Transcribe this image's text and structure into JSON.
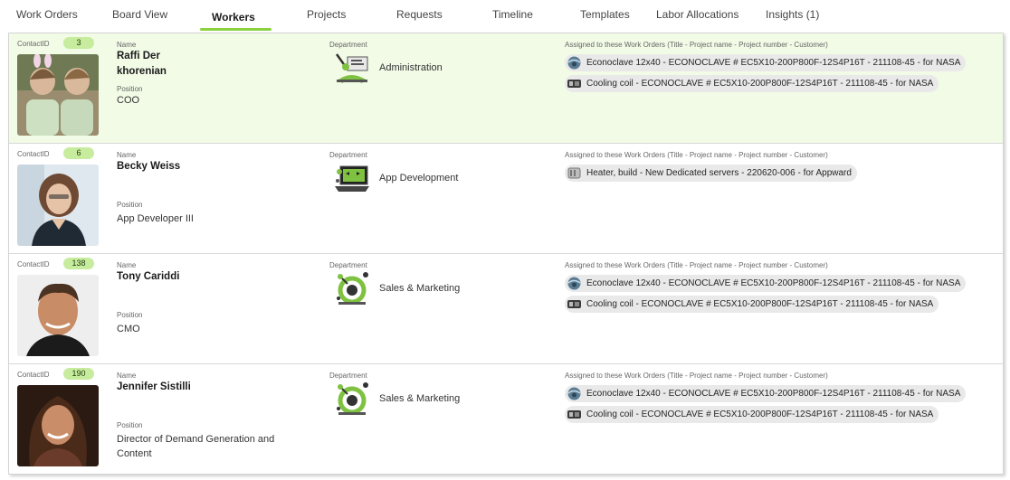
{
  "tabs": [
    {
      "label": "Work Orders"
    },
    {
      "label": "Board View"
    },
    {
      "label": "Workers",
      "active": true
    },
    {
      "label": "Projects"
    },
    {
      "label": "Requests"
    },
    {
      "label": "Timeline"
    },
    {
      "label": "Templates"
    },
    {
      "label": "Labor Allocations"
    },
    {
      "label": "Insights (1)"
    }
  ],
  "colors": {
    "accent": "#8cd140",
    "selected_row": "#f1fbe6",
    "badge": "#c7ec9d",
    "pill": "#e9e9e9"
  },
  "labels": {
    "contact_id": "ContactID",
    "name": "Name",
    "position": "Position",
    "department": "Department",
    "assigned": "Assigned to these Work Orders (Title - Project name - Project number - Customer)"
  },
  "workers": [
    {
      "contact_id": "3",
      "name": "Raffi Der khorenian",
      "position": "COO",
      "department": "Administration",
      "department_icon": "administration-icon",
      "photo": "avatar-photo",
      "selected": true,
      "work_orders": [
        {
          "text": "Econoclave 12x40 - ECONOCLAVE # EC5X10-200P800F-12S4P16T - 211108-45 - for NASA",
          "icon": "econoclave-icon"
        },
        {
          "text": "Cooling coil - ECONOCLAVE # EC5X10-200P800F-12S4P16T - 211108-45 - for NASA",
          "icon": "cooling-coil-icon"
        }
      ]
    },
    {
      "contact_id": "6",
      "name": "Becky Weiss",
      "position": "App Developer III",
      "department": "App Development",
      "department_icon": "app-development-icon",
      "photo": "avatar-photo",
      "selected": false,
      "work_orders": [
        {
          "text": "Heater, build - New Dedicated servers - 220620-006 - for Appward",
          "icon": "heater-icon"
        }
      ]
    },
    {
      "contact_id": "138",
      "name": "Tony Cariddi",
      "position": "CMO",
      "department": "Sales & Marketing",
      "department_icon": "sales-marketing-icon",
      "photo": "avatar-photo",
      "selected": false,
      "work_orders": [
        {
          "text": "Econoclave 12x40 - ECONOCLAVE # EC5X10-200P800F-12S4P16T - 211108-45 - for NASA",
          "icon": "econoclave-icon"
        },
        {
          "text": "Cooling coil - ECONOCLAVE # EC5X10-200P800F-12S4P16T - 211108-45 - for NASA",
          "icon": "cooling-coil-icon"
        }
      ]
    },
    {
      "contact_id": "190",
      "name": "Jennifer Sistilli",
      "position": "Director of Demand Generation and Content",
      "department": "Sales & Marketing",
      "department_icon": "sales-marketing-icon",
      "photo": "avatar-photo",
      "selected": false,
      "work_orders": [
        {
          "text": "Econoclave 12x40 - ECONOCLAVE # EC5X10-200P800F-12S4P16T - 211108-45 - for NASA",
          "icon": "econoclave-icon"
        },
        {
          "text": "Cooling coil - ECONOCLAVE # EC5X10-200P800F-12S4P16T - 211108-45 - for NASA",
          "icon": "cooling-coil-icon"
        }
      ]
    }
  ]
}
